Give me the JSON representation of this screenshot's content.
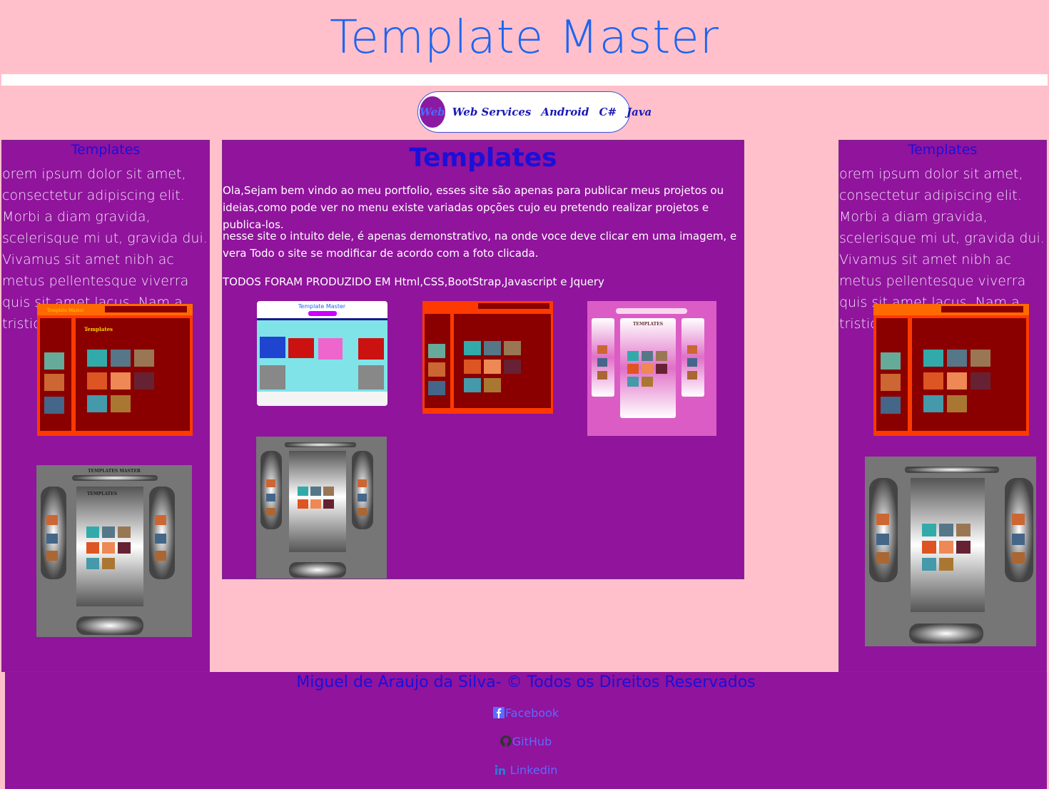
{
  "header": {
    "title": "Template Master"
  },
  "nav": {
    "items": [
      {
        "label": "Web",
        "active": true
      },
      {
        "label": "Web Services",
        "active": false
      },
      {
        "label": "Android",
        "active": false
      },
      {
        "label": "C#",
        "active": false
      },
      {
        "label": "Java",
        "active": false
      }
    ]
  },
  "left_sidebar": {
    "title": "Templates",
    "text": "orem ipsum dolor sit amet, consectetur adipiscing elit. Morbi a diam gravida, scelerisque mi ut, gravida dui. Vivamus sit amet nibh ac metus pellentesque viverra quis sit amet lacus. Nam a tristique nisi."
  },
  "right_sidebar": {
    "title": "Templates",
    "text": "orem ipsum dolor sit amet, consectetur adipiscing elit. Morbi a diam gravida, scelerisque mi ut, gravida dui. Vivamus sit amet nibh ac metus pellentesque viverra quis sit amet lacus. Nam a tristique nisi."
  },
  "main": {
    "title": "Templates",
    "paragraph_1": "Ola,Sejam bem vindo ao meu portfolio, esses site são apenas para publicar meus projetos ou ideias,como pode ver no menu existe variadas opções cujo eu pretendo realizar projetos e publica-los.",
    "paragraph_2": "nesse site o intuito dele, é apenas demonstrativo, na onde voce deve clicar em uma imagem, e vera Todo o site se modificar de acordo com a foto clicada.",
    "paragraph_3": "TODOS FORAM PRODUZIDO EM Html,CSS,BootStrap,Javascript e Jquery"
  },
  "thumbnails": {
    "blue_title": "Template Master",
    "red_title": "Template Master",
    "red_heading": "Templates",
    "pink_heading": "TEMPLATES",
    "gray_header": "TEMPLATES MASTER",
    "gray_heading": "TEMPLATES"
  },
  "footer": {
    "credit": "Miguel de Araujo da Silva- © Todos os Direitos Reservados",
    "links": [
      {
        "label": "Facebook",
        "icon": "facebook-icon"
      },
      {
        "label": "GitHub",
        "icon": "github-icon"
      },
      {
        "label": "Linkedin",
        "icon": "linkedin-icon"
      }
    ]
  },
  "colors": {
    "page_bg": "#ffc0cb",
    "panel_purple": "#90149c",
    "title_blue": "#1e64f0",
    "heading_blue": "#1b10d8"
  }
}
